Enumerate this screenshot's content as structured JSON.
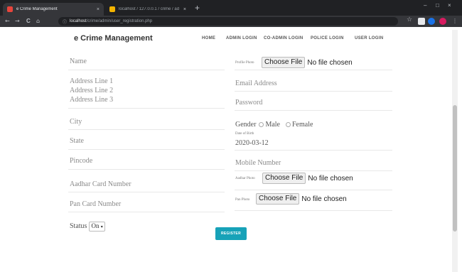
{
  "browser": {
    "tabs": [
      {
        "title": "e Crime Management",
        "active": true,
        "favicon_color": "#e8453c"
      },
      {
        "title": "localhost / 127.0.0.1 / crime / ad",
        "active": false,
        "favicon_color": "#f4b400"
      }
    ],
    "close_glyph": "×",
    "new_tab_glyph": "+",
    "window": {
      "minimize": "–",
      "maximize": "□",
      "close": "×"
    },
    "nav": {
      "back": "←",
      "forward": "→",
      "reload": "C",
      "home": "⌂"
    },
    "info_glyph": "ⓘ",
    "url_host": "localhost",
    "url_path": "/crime/admin/user_registration.php",
    "star_glyph": "☆",
    "extensions": [
      "#ffffff",
      "#1a73e8",
      "#34a853",
      "#d81b60"
    ],
    "menu_glyph": "⋮"
  },
  "header": {
    "brand": "e Crime Management",
    "nav": [
      "HOME",
      "ADMIN LOGIN",
      "CO-ADMIN LOGIN",
      "POLICE LOGIN",
      "USER LOGIN"
    ]
  },
  "form": {
    "left": {
      "name": "Name",
      "address1": "Address Line 1",
      "address2": "Address Line 2",
      "address3": "Address Line 3",
      "city": "City",
      "state": "State",
      "pincode": "Pincode",
      "aadhar_number": "Aadhar Card Number",
      "pan_number": "Pan Card Number",
      "status_label": "Status",
      "status_value": "On",
      "status_arrow": "▾"
    },
    "right": {
      "profile_photo_label": "Profile Photo",
      "email": "Email Address",
      "password": "Password",
      "gender_label": "Gender",
      "gender_male": "Male",
      "gender_female": "Female",
      "dob_label": "Date of Birth",
      "dob_value": "2020-03-12",
      "mobile": "Mobile Number",
      "aadhar_photo_label": "Aadhar Photo",
      "pan_photo_label": "Pan Photo"
    },
    "file_button": "Choose File",
    "file_none": "No file chosen",
    "register": "REGISTER"
  },
  "colors": {
    "accent": "#17a2b8"
  }
}
